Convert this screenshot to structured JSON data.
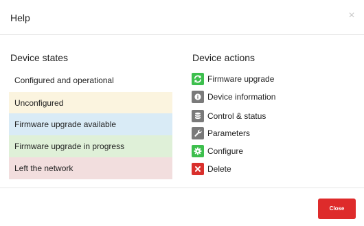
{
  "header": {
    "title": "Help",
    "close_glyph": "×"
  },
  "states": {
    "title": "Device states",
    "items": [
      {
        "label": "Configured and operational",
        "color": "#ffffff"
      },
      {
        "label": "Unconfigured",
        "color": "#fbf4df"
      },
      {
        "label": "Firmware upgrade available",
        "color": "#d9ebf6"
      },
      {
        "label": "Firmware upgrade in progress",
        "color": "#dff0d8"
      },
      {
        "label": "Left the network",
        "color": "#f2dede"
      }
    ]
  },
  "actions": {
    "title": "Device actions",
    "items": [
      {
        "label": "Firmware upgrade",
        "icon": "refresh-icon",
        "color": "#3dbf4d"
      },
      {
        "label": "Device information",
        "icon": "info-icon",
        "color": "#7a7a7a"
      },
      {
        "label": "Control & status",
        "icon": "database-icon",
        "color": "#7a7a7a"
      },
      {
        "label": "Parameters",
        "icon": "wrench-icon",
        "color": "#7a7a7a"
      },
      {
        "label": "Configure",
        "icon": "gear-icon",
        "color": "#3dbf4d"
      },
      {
        "label": "Delete",
        "icon": "close-icon",
        "color": "#d9302c"
      }
    ]
  },
  "footer": {
    "close_label": "Close",
    "close_color": "#de2b2b"
  }
}
